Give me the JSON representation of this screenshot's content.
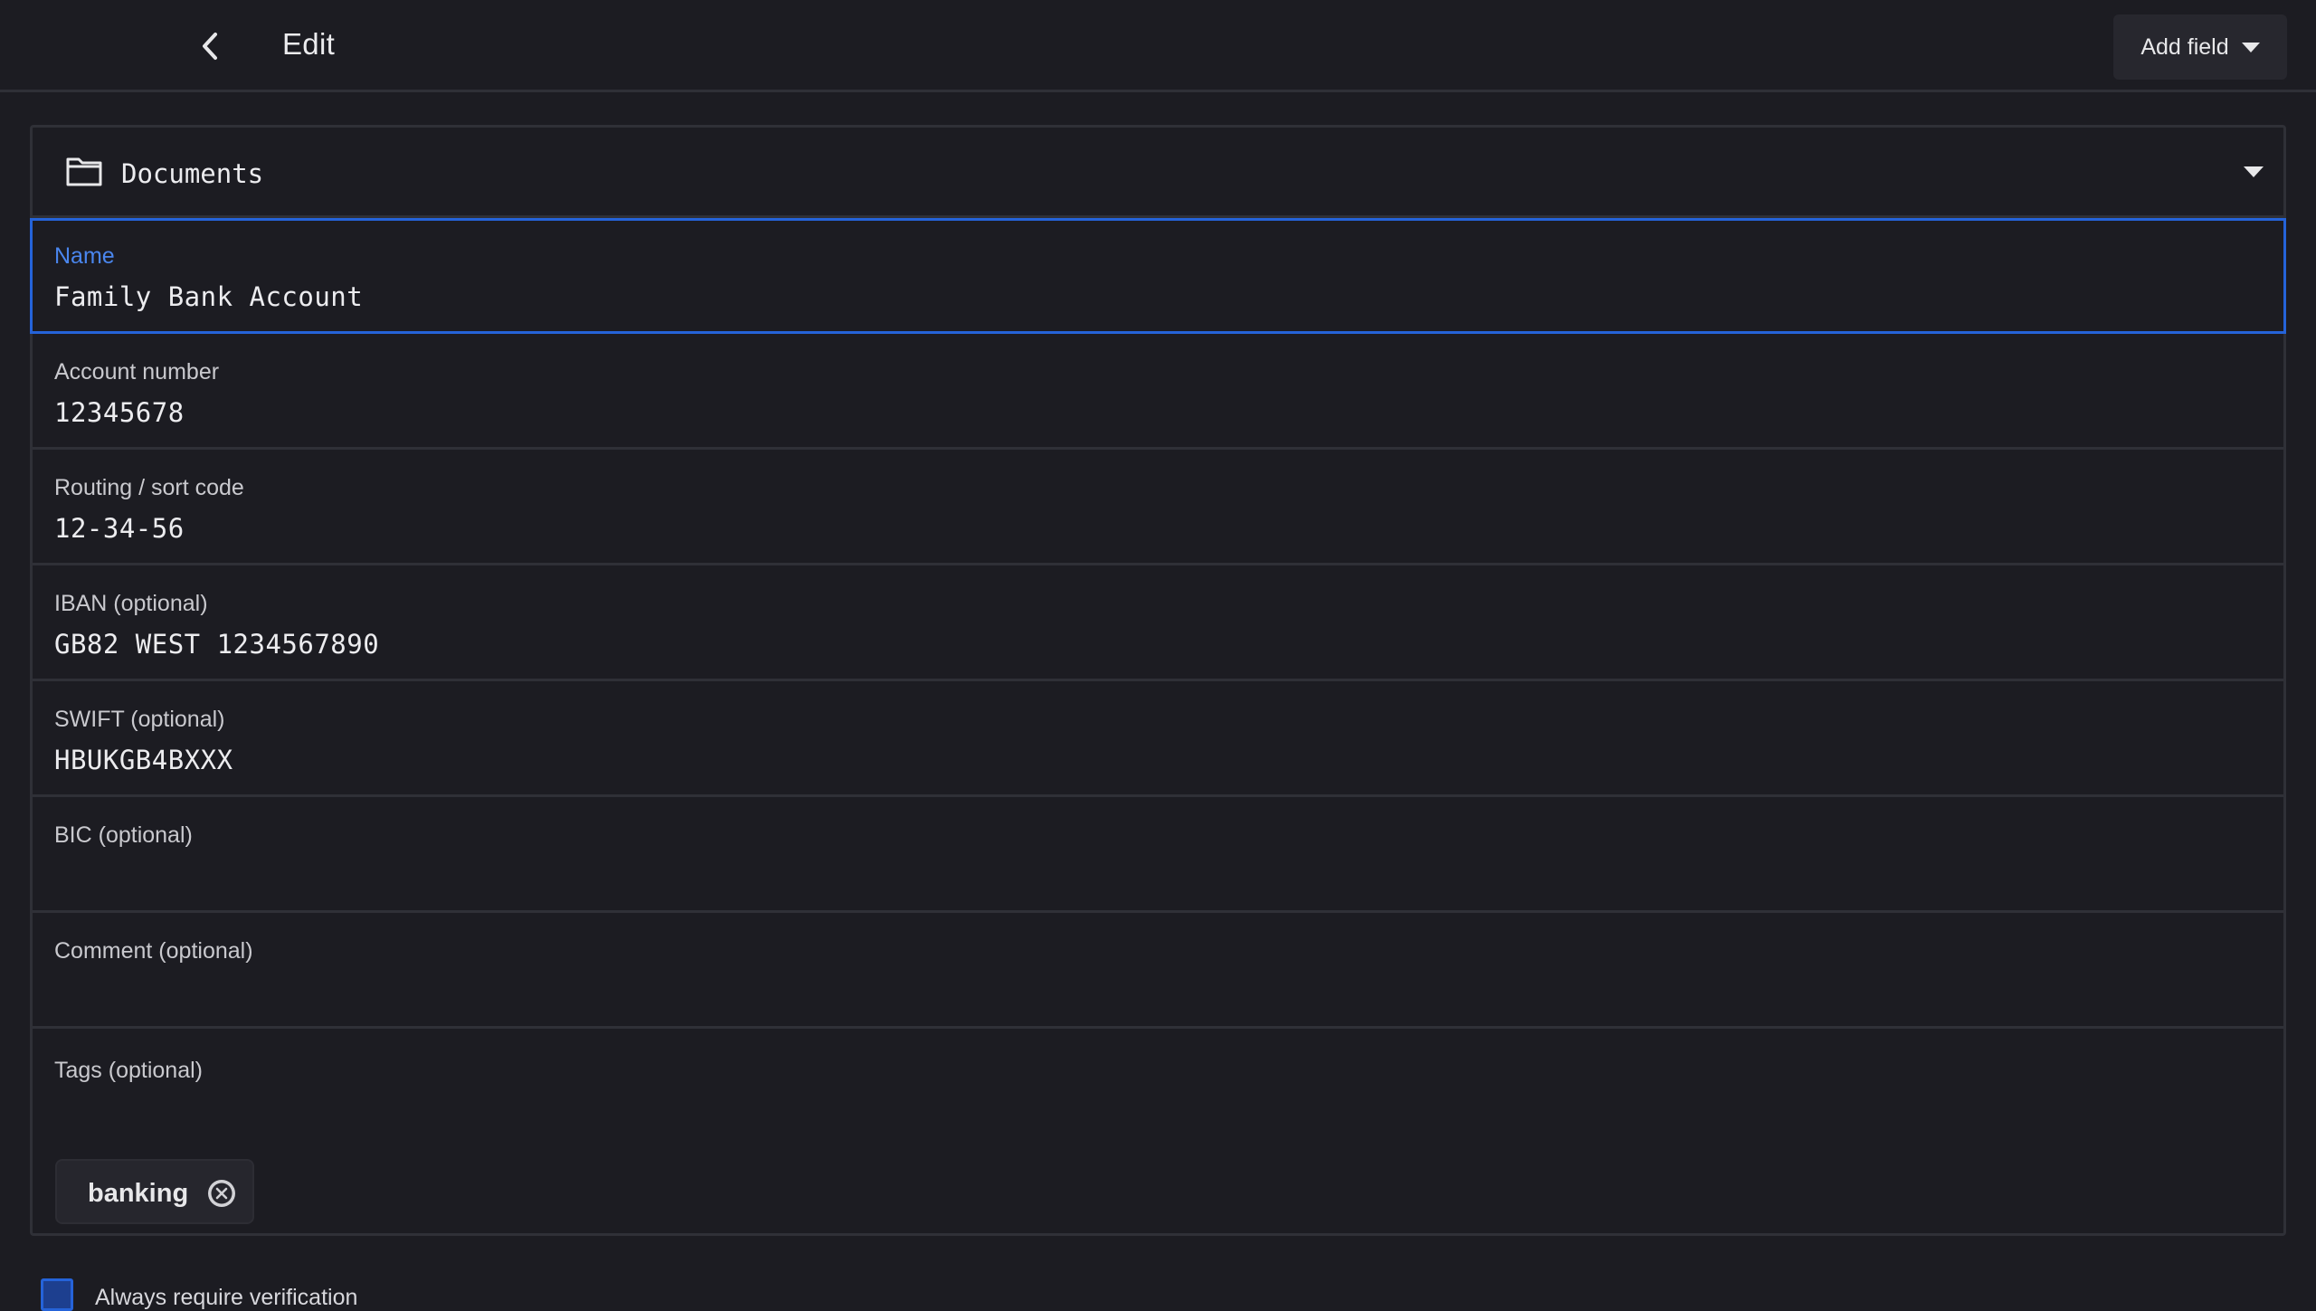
{
  "header": {
    "title": "Edit",
    "add_field_label": "Add field"
  },
  "folder": {
    "label": "Documents"
  },
  "fields": [
    {
      "label": "Name",
      "value": "Family Bank Account"
    },
    {
      "label": "Account number",
      "value": "12345678"
    },
    {
      "label": "Routing / sort code",
      "value": "12-34-56"
    },
    {
      "label": "IBAN (optional)",
      "value": "GB82 WEST 1234567890"
    },
    {
      "label": "SWIFT (optional)",
      "value": "HBUKGB4BXXX"
    },
    {
      "label": "BIC (optional)",
      "value": ""
    },
    {
      "label": "Comment (optional)",
      "value": ""
    }
  ],
  "tags": {
    "label": "Tags (optional)",
    "items": [
      "banking"
    ]
  },
  "verification": {
    "label": "Always require verification"
  },
  "colors": {
    "accent": "#2563d9",
    "background": "#1c1c22",
    "divider": "#2f3037"
  }
}
